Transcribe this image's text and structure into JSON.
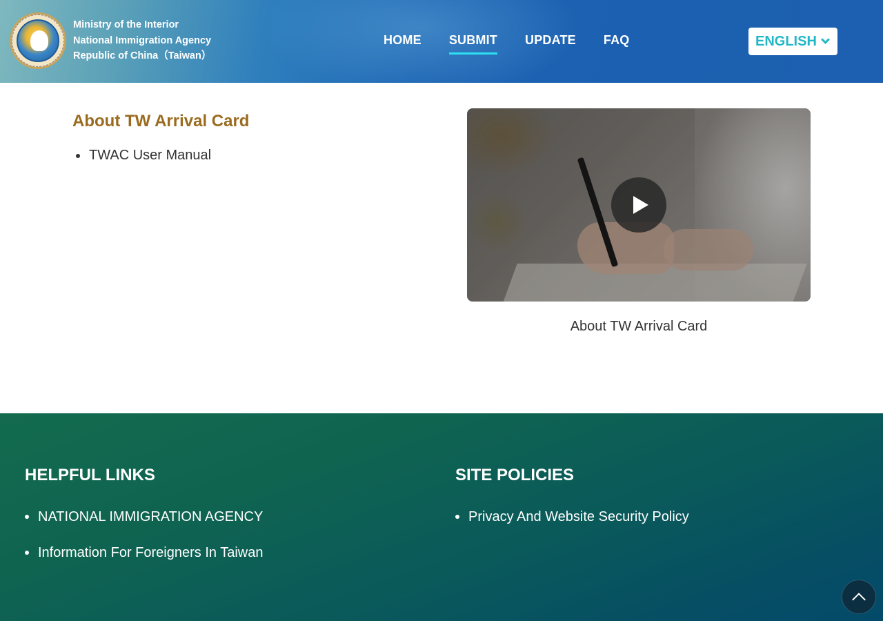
{
  "header": {
    "org_lines": [
      "Ministry of the Interior",
      "National Immigration Agency",
      "Republic of China（Taiwan）"
    ],
    "nav": [
      {
        "label": "HOME",
        "active": false
      },
      {
        "label": "SUBMIT",
        "active": true
      },
      {
        "label": "UPDATE",
        "active": false
      },
      {
        "label": "FAQ",
        "active": false
      }
    ],
    "language": {
      "selected": "ENGLISH",
      "icon": "chevron-down-icon"
    },
    "colors": {
      "accent_underline": "#2ee0f0",
      "language_text": "#22b7c4"
    }
  },
  "main": {
    "about_title": "About TW Arrival Card",
    "links": [
      "TWAC User Manual"
    ],
    "video": {
      "caption": "About TW Arrival Card",
      "play_icon": "play-icon"
    },
    "colors": {
      "title": "#9a6b1f"
    }
  },
  "footer": {
    "helpful_links": {
      "heading": "HELPFUL LINKS",
      "items": [
        "NATIONAL IMMIGRATION AGENCY",
        "Information For Foreigners In Taiwan"
      ]
    },
    "site_policies": {
      "heading": "SITE POLICIES",
      "items": [
        "Privacy And Website Security Policy"
      ]
    },
    "back_to_top_icon": "chevron-up-icon"
  }
}
